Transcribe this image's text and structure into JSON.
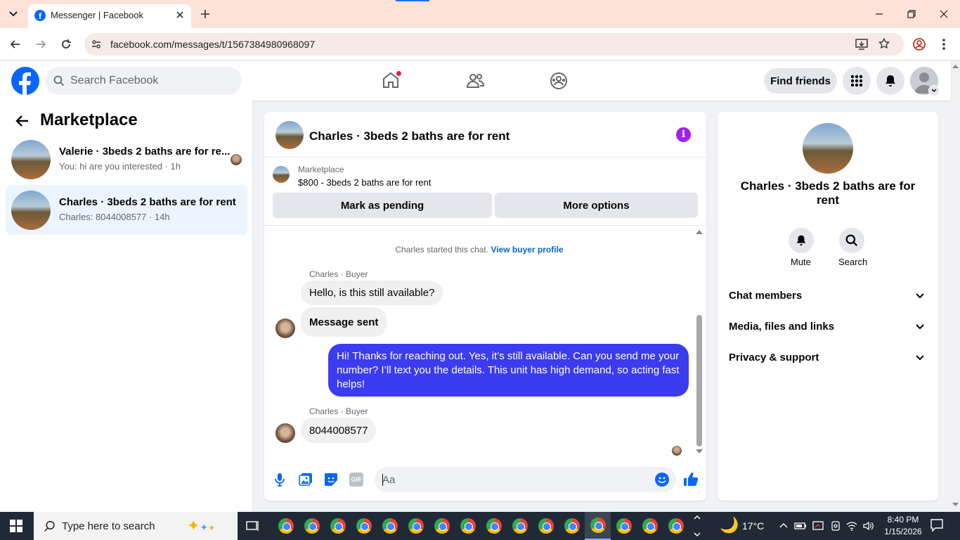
{
  "browser": {
    "tab_title": "Messenger | Facebook",
    "url": "facebook.com/messages/t/1567384980968097"
  },
  "header": {
    "search_placeholder": "Search Facebook",
    "find_friends": "Find friends"
  },
  "sidebar": {
    "title": "Marketplace",
    "conversations": [
      {
        "title": "Valerie · 3beds 2 baths are for re...",
        "preview": "You: hi are you interested · 1h"
      },
      {
        "title": "Charles · 3beds 2 baths are for rent",
        "preview": "Charles: 8044008577 · 14h"
      }
    ]
  },
  "chat": {
    "header_title": "Charles · 3beds 2 baths are for rent",
    "listing_source": "Marketplace",
    "listing_title": "$800 - 3beds 2 baths are for rent",
    "mark_pending": "Mark as pending",
    "more_options": "More options",
    "started_text": "Charles started this chat.",
    "view_profile": "View buyer profile",
    "sender_label_1": "Charles · Buyer",
    "msg_1": "Hello, is this still available?",
    "msg_2": "Message sent",
    "msg_3": "Hi! Thanks for reaching out. Yes, it’s still available. Can you send me your number? I’ll text you the details. This unit has high demand, so acting fast helps!",
    "sender_label_2": "Charles · Buyer",
    "msg_4": "8044008577",
    "input_placeholder": "Aa",
    "gif_label": "GIF"
  },
  "info": {
    "name": "Charles · 3beds 2 baths are for rent",
    "mute": "Mute",
    "search": "Search",
    "sections": [
      "Chat members",
      "Media, files and links",
      "Privacy & support"
    ]
  },
  "taskbar": {
    "search_placeholder": "Type here to search",
    "weather": "17°C",
    "time": "8:40 PM",
    "date": "1/15/2026"
  },
  "colors": {
    "fb_blue": "#0866ff",
    "outgoing_bubble": "#3b3bf0",
    "info_purple": "#a020f0",
    "sidebar_active": "#ebf5ff"
  }
}
